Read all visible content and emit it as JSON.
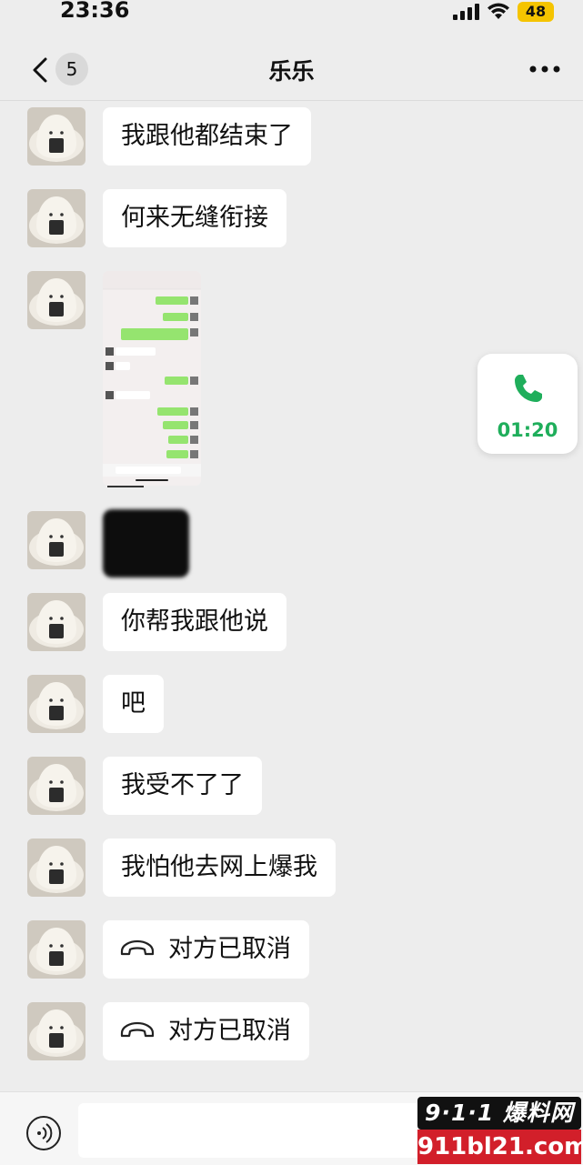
{
  "status_bar": {
    "time": "23:36",
    "battery": "48"
  },
  "header": {
    "unread_count": "5",
    "title": "乐乐"
  },
  "messages": [
    {
      "type": "text",
      "text": "我跟他都结束了"
    },
    {
      "type": "text",
      "text": "何来无缝衔接"
    },
    {
      "type": "image",
      "description": "chat screenshot"
    },
    {
      "type": "censored"
    },
    {
      "type": "text",
      "text": "你帮我跟他说"
    },
    {
      "type": "text",
      "text": "吧"
    },
    {
      "type": "text",
      "text": "我受不了了"
    },
    {
      "type": "text",
      "text": "我怕他去网上爆我"
    },
    {
      "type": "call",
      "text": "对方已取消"
    },
    {
      "type": "call",
      "text": "对方已取消"
    }
  ],
  "floating_call": {
    "duration": "01:20"
  },
  "input": {
    "placeholder": ""
  },
  "watermark": {
    "line1": "9·1·1 爆料网",
    "line2": "911bl21.com"
  },
  "colors": {
    "bubble": "#ffffff",
    "background": "#ededed",
    "call_green": "#1fae5b",
    "watermark_red": "#d21f2a"
  }
}
